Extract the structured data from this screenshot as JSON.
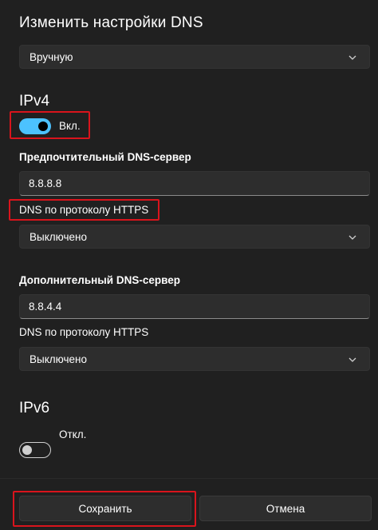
{
  "dialog": {
    "title": "Изменить настройки DNS",
    "mode_select": {
      "value": "Вручную"
    }
  },
  "ipv4": {
    "heading": "IPv4",
    "toggle": {
      "state": "on",
      "label": "Вкл."
    },
    "preferred": {
      "label": "Предпочтительный DNS-сервер",
      "value": "8.8.8.8",
      "https_label": "DNS по протоколу HTTPS",
      "https_value": "Выключено"
    },
    "alternate": {
      "label": "Дополнительный DNS-сервер",
      "value": "8.8.4.4",
      "https_label": "DNS по протоколу HTTPS",
      "https_value": "Выключено"
    }
  },
  "ipv6": {
    "heading": "IPv6",
    "toggle": {
      "state": "off",
      "label": "Откл."
    }
  },
  "footer": {
    "save_label": "Сохранить",
    "cancel_label": "Отмена"
  },
  "colors": {
    "background": "#202020",
    "control": "#2d2d2d",
    "accent": "#4cc2ff",
    "highlight": "#d9141c"
  },
  "icons": {
    "dropdown": "chevron-down-icon"
  }
}
